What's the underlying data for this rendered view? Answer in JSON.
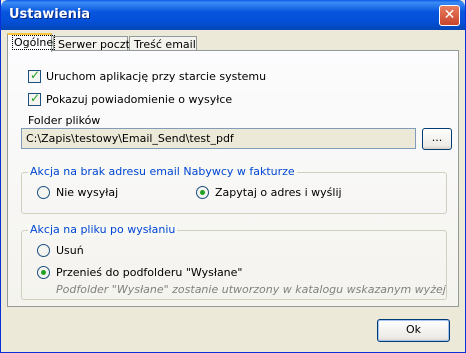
{
  "window": {
    "title": "Ustawienia"
  },
  "tabs": [
    {
      "label": "Ogólne"
    },
    {
      "label": "Serwer poczty"
    },
    {
      "label": "Treść email"
    }
  ],
  "general": {
    "startup_checkbox": {
      "label": "Uruchom aplikację przy starcie systemu",
      "checked": true
    },
    "notify_checkbox": {
      "label": "Pokazuj powiadomienie o wysyłce",
      "checked": true
    },
    "folder_label": "Folder plików",
    "folder_value": "C:\\Zapis\\testowy\\Email_Send\\test_pdf",
    "browse_label": "..."
  },
  "no_email_group": {
    "title": "Akcja na brak adresu email Nabywcy w fakturze",
    "options": [
      {
        "label": "Nie wysyłaj",
        "selected": false
      },
      {
        "label": "Zapytaj o adres i wyślij",
        "selected": true
      }
    ]
  },
  "after_send_group": {
    "title": "Akcja na pliku po wysłaniu",
    "options": [
      {
        "label": "Usuń",
        "selected": false
      },
      {
        "label": "Przenieś do podfolderu \"Wysłane\"",
        "selected": true
      }
    ],
    "note": "Podfolder \"Wysłane\" zostanie utworzony w katalogu wskazanym wyżej"
  },
  "footer": {
    "ok_label": "Ok"
  },
  "colors": {
    "titlebar": "#0454d9",
    "group_title": "#0046d5",
    "check": "#21a121"
  }
}
